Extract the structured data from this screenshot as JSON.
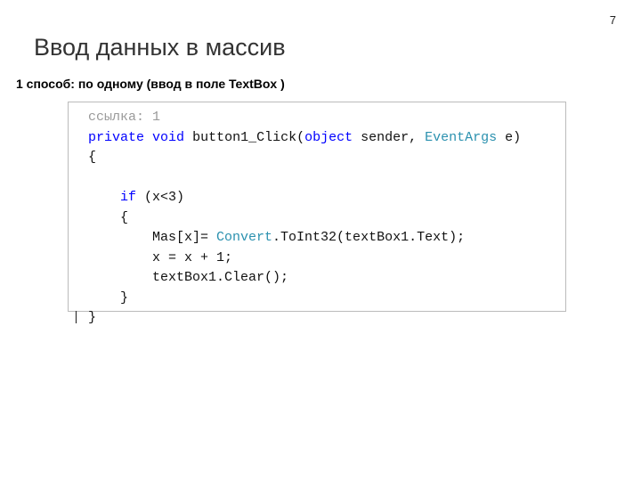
{
  "page_number": "7",
  "title": "Ввод данных в массив",
  "subtitle": "1 способ: по одному (ввод в поле TextBox )",
  "code": {
    "ref_label": "ссылка: 1",
    "kw_private": "private",
    "kw_void": "void",
    "method_name": "button1_Click",
    "kw_object": "object",
    "param1": " sender, ",
    "type_eventargs": "EventArgs",
    "param2": " e)",
    "open_brace": "{",
    "kw_if": "if",
    "if_cond": " (x<3)",
    "inner_open": "{",
    "line_mas": "Mas[x]= ",
    "type_convert": "Convert",
    "line_mas2": ".ToInt32(textBox1.Text);",
    "line_x": "x = x + 1;",
    "line_clear": "textBox1.Clear();",
    "inner_close": "}",
    "close_brace": "}"
  }
}
